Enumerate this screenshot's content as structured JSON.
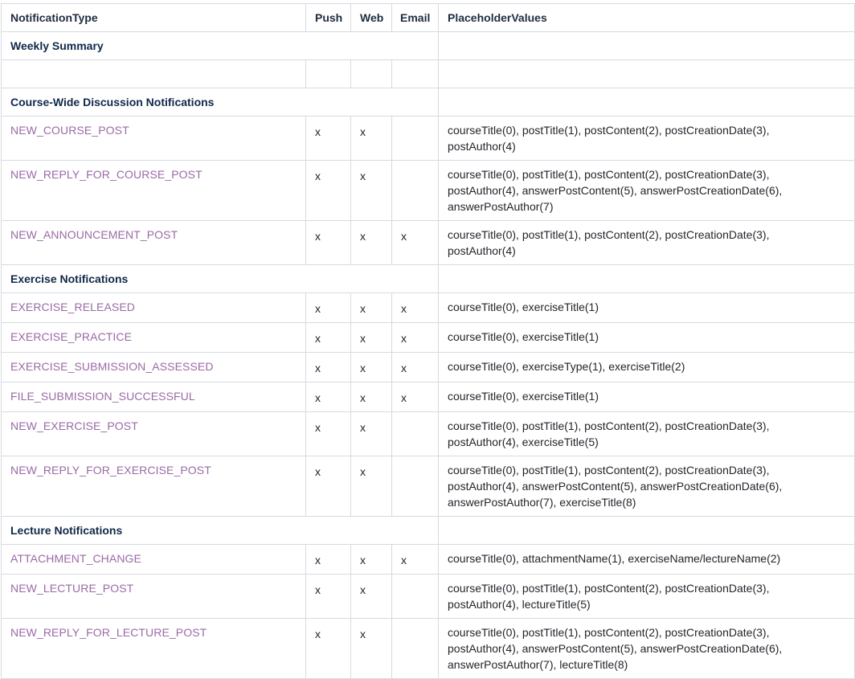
{
  "header": {
    "type": "NotificationType",
    "push": "Push",
    "web": "Web",
    "email": "Email",
    "placeholders": "PlaceholderValues"
  },
  "sections": [
    {
      "title": "Weekly Summary",
      "rows": []
    },
    {
      "title": "Course-Wide Discussion Notifications",
      "rows": [
        {
          "type": "NEW_COURSE_POST",
          "push": "x",
          "web": "x",
          "email": "",
          "placeholders": "courseTitle(0), postTitle(1), postContent(2), postCreationDate(3), postAuthor(4)"
        },
        {
          "type": "NEW_REPLY_FOR_COURSE_POST",
          "push": "x",
          "web": "x",
          "email": "",
          "placeholders": "courseTitle(0), postTitle(1), postContent(2), postCreationDate(3), postAuthor(4), answerPostContent(5), answerPostCreationDate(6), answerPostAuthor(7)"
        },
        {
          "type": "NEW_ANNOUNCEMENT_POST",
          "push": "x",
          "web": "x",
          "email": "x",
          "placeholders": "courseTitle(0), postTitle(1), postContent(2), postCreationDate(3), postAuthor(4)"
        }
      ]
    },
    {
      "title": "Exercise Notifications",
      "rows": [
        {
          "type": "EXERCISE_RELEASED",
          "push": "x",
          "web": "x",
          "email": "x",
          "placeholders": "courseTitle(0), exerciseTitle(1)"
        },
        {
          "type": "EXERCISE_PRACTICE",
          "push": "x",
          "web": "x",
          "email": "x",
          "placeholders": "courseTitle(0), exerciseTitle(1)"
        },
        {
          "type": "EXERCISE_SUBMISSION_ASSESSED",
          "push": "x",
          "web": "x",
          "email": "x",
          "placeholders": "courseTitle(0), exerciseType(1), exerciseTitle(2)"
        },
        {
          "type": "FILE_SUBMISSION_SUCCESSFUL",
          "push": "x",
          "web": "x",
          "email": "x",
          "placeholders": "courseTitle(0), exerciseTitle(1)"
        },
        {
          "type": "NEW_EXERCISE_POST",
          "push": "x",
          "web": "x",
          "email": "",
          "placeholders": "courseTitle(0), postTitle(1), postContent(2), postCreationDate(3), postAuthor(4), exerciseTitle(5)"
        },
        {
          "type": "NEW_REPLY_FOR_EXERCISE_POST",
          "push": "x",
          "web": "x",
          "email": "",
          "placeholders": "courseTitle(0), postTitle(1), postContent(2), postCreationDate(3), postAuthor(4), answerPostContent(5), answerPostCreationDate(6), answerPostAuthor(7), exerciseTitle(8)"
        }
      ]
    },
    {
      "title": "Lecture Notifications",
      "rows": [
        {
          "type": "ATTACHMENT_CHANGE",
          "push": "x",
          "web": "x",
          "email": "x",
          "placeholders": "courseTitle(0), attachmentName(1), exerciseName/lectureName(2)"
        },
        {
          "type": "NEW_LECTURE_POST",
          "push": "x",
          "web": "x",
          "email": "",
          "placeholders": "courseTitle(0), postTitle(1), postContent(2), postCreationDate(3), postAuthor(4), lectureTitle(5)"
        },
        {
          "type": "NEW_REPLY_FOR_LECTURE_POST",
          "push": "x",
          "web": "x",
          "email": "",
          "placeholders": "courseTitle(0), postTitle(1), postContent(2), postCreationDate(3), postAuthor(4), answerPostContent(5), answerPostCreationDate(6), answerPostAuthor(7), lectureTitle(8)"
        }
      ]
    }
  ]
}
